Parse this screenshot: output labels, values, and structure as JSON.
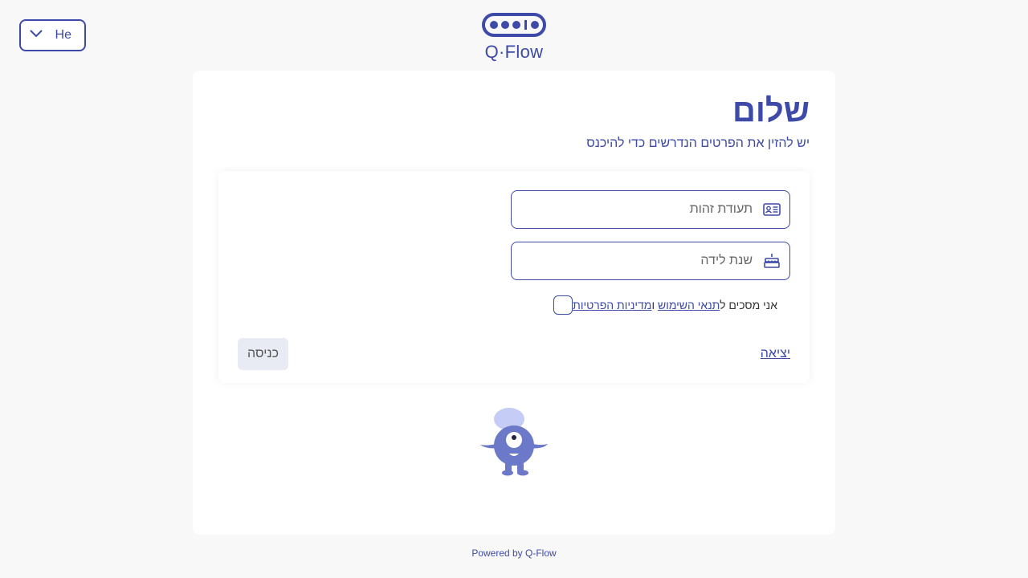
{
  "language": {
    "selected": "He"
  },
  "brand": {
    "name": "Q·Flow"
  },
  "login": {
    "title": "שלום",
    "subtitle": "יש להזין את הפרטים הנדרשים כדי להיכנס",
    "id_placeholder": "תעודת זהות",
    "birth_year_placeholder": "שנת לידה",
    "consent_prefix": "אני מסכים ל",
    "terms_link": "תנאי השימוש",
    "consent_and": " ו",
    "privacy_link": "מדיניות הפרטיות",
    "exit_label": "יציאה",
    "enter_label": "כניסה"
  },
  "footer": {
    "text": "Powered by Q-Flow"
  },
  "colors": {
    "accent": "#3d4aa8",
    "button_disabled_bg": "#e8eaf4",
    "mascot": "#6c78c8"
  },
  "icons": {
    "language": "chevron-down-icon",
    "id_field": "id-card-icon",
    "birth_field": "cake-icon"
  }
}
